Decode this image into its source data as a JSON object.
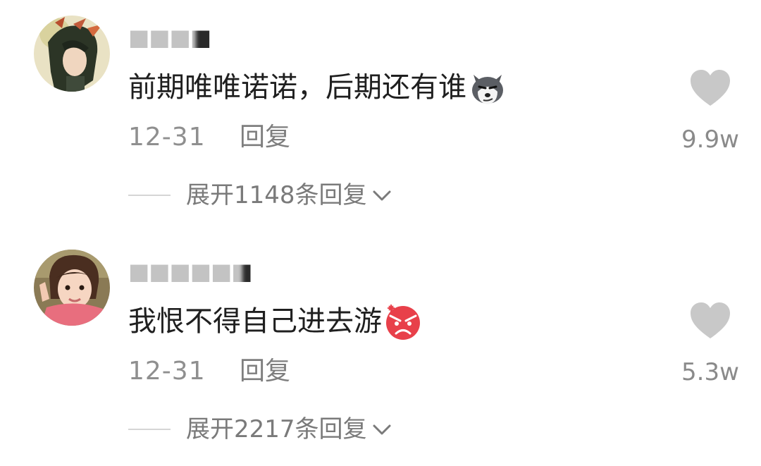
{
  "comments": [
    {
      "username": "■■■■",
      "text": "前期唯唯诺诺，后期还有谁",
      "emoji": "husky-smirk-emoji",
      "date": "12-31",
      "reply_label": "回复",
      "expand_label": "展开1148条回复",
      "likes": "9.9w"
    },
    {
      "username": "■■■■■■",
      "text": "我恨不得自己进去游",
      "emoji": "angry-face-emoji",
      "date": "12-31",
      "reply_label": "回复",
      "expand_label": "展开2217条回复",
      "likes": "5.3w"
    }
  ],
  "colors": {
    "heart": "#c8c8c8",
    "meta": "#8f8f8f",
    "text": "#1f1f1f",
    "angry": "#e8404a"
  }
}
